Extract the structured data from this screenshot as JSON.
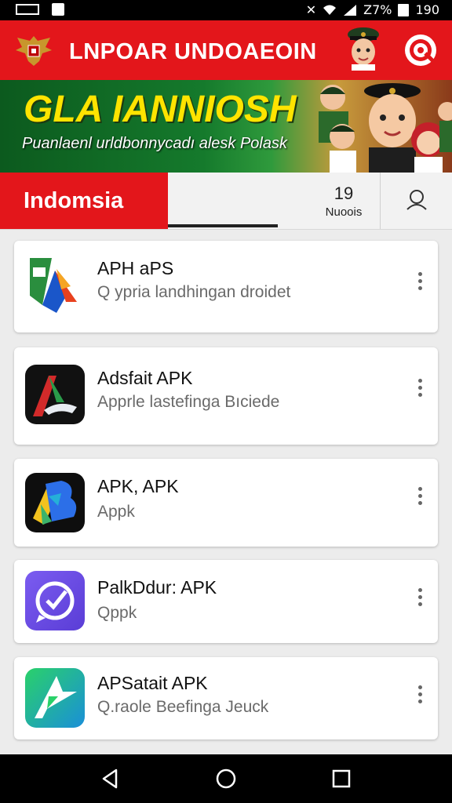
{
  "status_bar": {
    "battery": "Z7%",
    "time": "190"
  },
  "header": {
    "title": "LNPOAR UNDOAEOIN"
  },
  "banner": {
    "title": "GLA IANNIOSH",
    "subtitle": "Puanlaenl urldbonnycadı alesk Polask"
  },
  "tabs": {
    "country": "Indomsia",
    "news_count": "19",
    "news_label": "Nuoois"
  },
  "apps": [
    {
      "name": "APH aPS",
      "desc": "Q ypria landhingan droidet",
      "icon": "google-maps-style-icon"
    },
    {
      "name": "Adsfait APK",
      "desc": "Apprle lastefinga Bıciede",
      "icon": "black-a-app-icon"
    },
    {
      "name": "APK, APK",
      "desc": "Appk",
      "icon": "colorful-b-app-icon"
    },
    {
      "name": "PalkDdur: APK",
      "desc": "Qppk",
      "icon": "purple-chat-app-icon"
    },
    {
      "name": "APSatait APK",
      "desc": "Q.raole Beefinga Jeuck",
      "icon": "green-arrow-app-icon"
    }
  ],
  "colors": {
    "brand_red": "#e3161b",
    "banner_title": "#ffe400"
  }
}
